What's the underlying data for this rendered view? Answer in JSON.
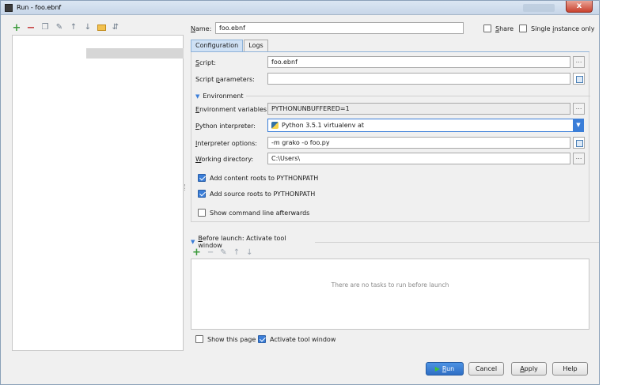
{
  "window": {
    "title": "Run - foo.ebnf",
    "close_label": "x"
  },
  "name_field": {
    "label_pre": "",
    "label_u": "N",
    "label_post": "ame:",
    "value": "foo.ebnf"
  },
  "share": {
    "label_u": "S",
    "label_post": "hare",
    "checked": false
  },
  "single_instance": {
    "label_pre": "Single ",
    "label_u": "i",
    "label_post": "nstance only",
    "checked": false
  },
  "tabs": [
    {
      "label": "Configuration",
      "active": true
    },
    {
      "label": "Logs",
      "active": false
    }
  ],
  "script": {
    "label_u": "S",
    "label_post": "cript:",
    "value": "foo.ebnf"
  },
  "script_params": {
    "label_pre": "Script ",
    "label_u": "p",
    "label_post": "arameters:",
    "value": ""
  },
  "environment": {
    "section_label": "Environment",
    "env_vars": {
      "label_u": "E",
      "label_post": "nvironment variables:",
      "value": "PYTHONUNBUFFERED=1"
    },
    "interpreter": {
      "label_u": "P",
      "label_post": "ython interpreter:",
      "value": "Python 3.5.1 virtualenv at"
    },
    "interpreter_options": {
      "label_pre": "",
      "label_u": "I",
      "label_post": "nterpreter options:",
      "value": "-m grako -o foo.py"
    },
    "working_dir": {
      "label_u": "W",
      "label_post": "orking directory:",
      "value": "C:\\Users\\"
    },
    "add_content_roots": {
      "label": "Add content roots to PYTHONPATH",
      "checked": true
    },
    "add_source_roots": {
      "label": "Add source roots to PYTHONPATH",
      "checked": true
    },
    "show_cmd": {
      "label": "Show command line afterwards",
      "checked": false
    }
  },
  "before_launch": {
    "label_u": "B",
    "label_post": "efore launch: Activate tool window",
    "empty_text": "There are no tasks to run before launch"
  },
  "footer": {
    "show_page": {
      "label": "Show this page",
      "checked": false
    },
    "activate_tool": {
      "label": "Activate tool window",
      "checked": true
    },
    "run_u": "R",
    "run_post": "un",
    "cancel": "Cancel",
    "apply_u": "A",
    "apply_post": "pply",
    "help": "Help"
  },
  "colors": {
    "accent": "#3b7ed8",
    "add_green": "#3c9b3c",
    "remove_red": "#c43c3c"
  }
}
